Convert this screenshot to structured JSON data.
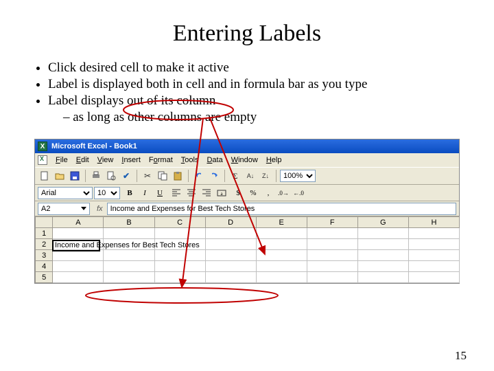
{
  "title": "Entering Labels",
  "bullets": {
    "b0": "Click desired cell to make it active",
    "b1": "Label is displayed both in cell and in formula bar as you type",
    "b2": "Label displays out of its column",
    "s0": "as long as other columns are empty"
  },
  "page_num": "15",
  "excel": {
    "titlebar": "Microsoft Excel - Book1",
    "menus": {
      "file": "File",
      "edit": "Edit",
      "view": "View",
      "insert": "Insert",
      "format": "Format",
      "tools": "Tools",
      "data": "Data",
      "window": "Window",
      "help": "Help"
    },
    "font_name": "Arial",
    "font_size": "10",
    "zoom": "100%",
    "namebox": "A2",
    "fx_label": "fx",
    "formula_value": "Income and Expenses for Best Tech Stores",
    "cols": {
      "A": "A",
      "B": "B",
      "C": "C",
      "D": "D",
      "E": "E",
      "F": "F",
      "G": "G",
      "H": "H"
    },
    "rows": {
      "r1": "1",
      "r2": "2",
      "r3": "3",
      "r4": "4",
      "r5": "5"
    },
    "cell_A2": "Income and Expenses for Best Tech Stores"
  }
}
